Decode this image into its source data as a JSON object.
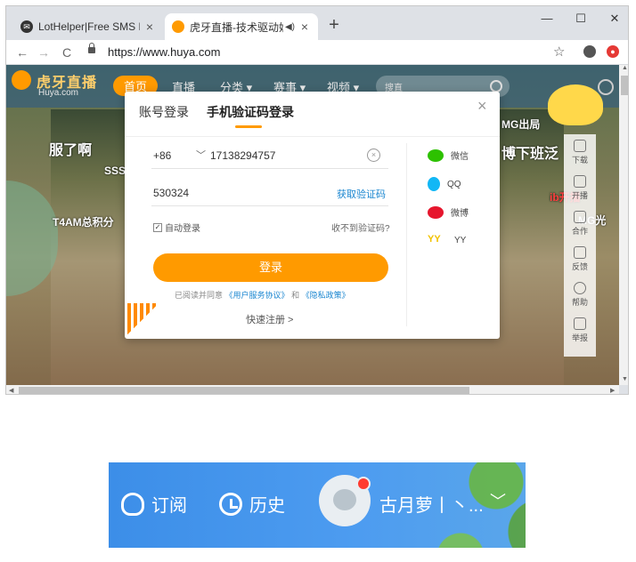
{
  "browser": {
    "tabs": [
      {
        "title": "LotHelper|Free SMS Rece",
        "close": "×"
      },
      {
        "title": "虎牙直播-技术驱动娱",
        "close": "×",
        "audio": "◀)"
      }
    ],
    "new_tab": "+",
    "window_controls": {
      "minimize": "—",
      "maximize": "☐",
      "close": "✕"
    },
    "nav": {
      "back": "←",
      "forward": "→",
      "reload": "C"
    },
    "url": "https://www.huya.com",
    "bookmark_icon": "☆"
  },
  "page": {
    "logo_text": "虎牙直播",
    "logo_sub": "Huya.com",
    "nav": [
      "首页",
      "直播",
      "分类 ▾",
      "赛事 ▾",
      "视频 ▾"
    ],
    "search_placeholder": "搜直",
    "overlay_texts": [
      "服了啊",
      "SSS",
      "T4AM总积分",
      "MG出局",
      "博下班泛",
      "ib开播",
      "MG光"
    ],
    "right_panel": [
      "下载",
      "开播",
      "合作",
      "反馈",
      "帮助",
      "举报"
    ]
  },
  "modal": {
    "tab_account": "账号登录",
    "tab_phone": "手机验证码登录",
    "close": "×",
    "country_code": "+86",
    "country_arrow": "﹀",
    "phone": "17138294757",
    "clear": "×",
    "code": "530324",
    "get_code": "获取验证码",
    "auto_login": "自动登录",
    "auto_check": "✓",
    "no_code": "收不到验证码?",
    "login_button": "登录",
    "agree_prefix": "已阅读并同意",
    "agree_terms": "《用户服务协议》",
    "agree_and": "和",
    "agree_privacy": "《隐私政策》",
    "quick_register": "快速注册 >",
    "social": [
      {
        "name": "微信",
        "icon": "wechat-icon"
      },
      {
        "name": "QQ",
        "icon": "qq-icon"
      },
      {
        "name": "微博",
        "icon": "weibo-icon"
      },
      {
        "name": "YY",
        "icon": "yy-icon",
        "glyph": "YY"
      }
    ]
  },
  "crop": {
    "subscribe": "订阅",
    "history": "历史",
    "username": "古月萝丨丶...",
    "chevron": "﹀"
  },
  "colors": {
    "accent": "#ff9a00",
    "link": "#1a86d0"
  }
}
